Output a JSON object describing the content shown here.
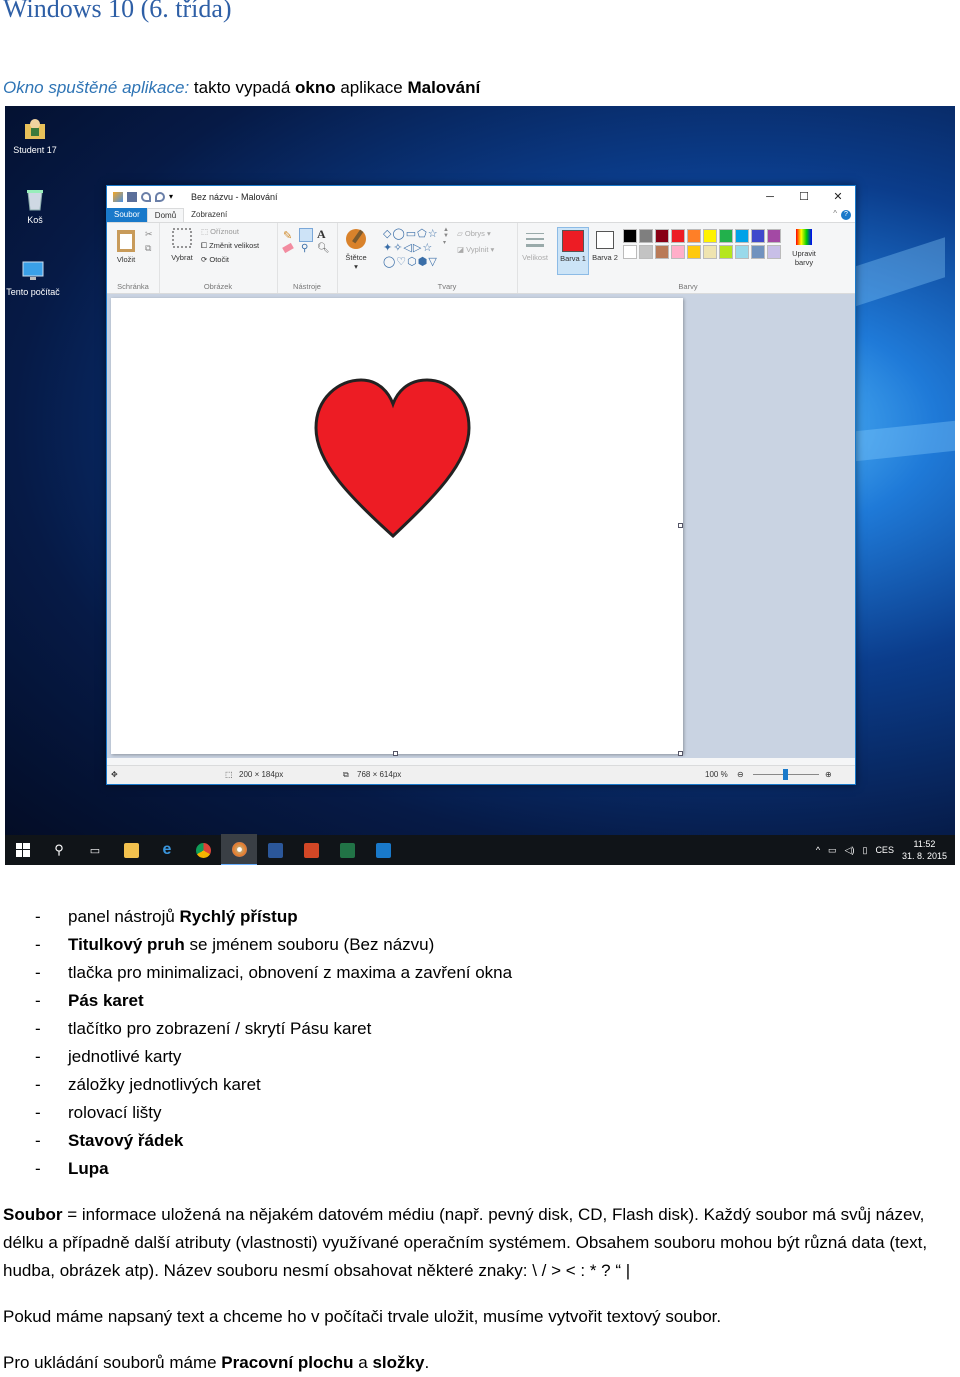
{
  "page": {
    "title": "Windows 10 (6. třída)",
    "intro": {
      "highlight": "Okno spuštěné aplikace:",
      "part1": " takto vypadá ",
      "bold1": "okno",
      "part2": " aplikace ",
      "bold2": "Malování"
    }
  },
  "screenshot": {
    "desktop_icons": [
      {
        "label": "Student 17",
        "icon": "user-folder-icon"
      },
      {
        "label": "Koš",
        "icon": "recycle-bin-icon"
      },
      {
        "label": "Tento počítač",
        "icon": "computer-icon"
      }
    ],
    "window": {
      "title": "Bez názvu - Malování",
      "controls": {
        "minimize": "─",
        "maximize": "☐",
        "close": "✕"
      },
      "tabs": [
        "Soubor",
        "Domů",
        "Zobrazení"
      ],
      "help": "?",
      "ribbon": {
        "groups": [
          "Schránka",
          "Obrázek",
          "Nástroje",
          "Tvary",
          "Barvy"
        ],
        "buttons": {
          "paste": "Vložit",
          "select": "Vybrat",
          "crop": "Oříznout",
          "resize": "Změnit velikost",
          "rotate": "Otočit",
          "brushes": "Štětce",
          "outline": "Obrys",
          "fill": "Vyplnit",
          "size": "Velikost",
          "color1": "Barva 1",
          "color2": "Barva 2",
          "edit_colors": "Upravit barvy"
        },
        "palette_row1": [
          "#000000",
          "#7f7f7f",
          "#880015",
          "#ed1c24",
          "#ff7f27",
          "#fff200",
          "#22b14c",
          "#00a2e8",
          "#3f48cc",
          "#a349a4"
        ],
        "palette_row2": [
          "#ffffff",
          "#c3c3c3",
          "#b97a57",
          "#ffaec9",
          "#ffc90e",
          "#efe4b0",
          "#b5e61d",
          "#99d9ea",
          "#7092be",
          "#c8bfe7"
        ],
        "color1_value": "#ed1c24"
      },
      "canvas": {
        "shape": "heart",
        "fill": "#ed1c24"
      },
      "statusbar": {
        "selection_size": "200 × 184px",
        "image_size": "768 × 614px",
        "zoom": "100 %",
        "zoom_out": "⊖",
        "zoom_in": "⊕"
      }
    },
    "taskbar": {
      "icons": [
        "start-icon",
        "search-icon",
        "task-view-icon",
        "file-explorer-icon",
        "edge-icon",
        "chrome-icon",
        "paint-icon",
        "word-icon",
        "powerpoint-icon",
        "excel-icon",
        "settings-icon"
      ],
      "lang": "CES",
      "time": "11:52",
      "date": "31. 8. 2015"
    }
  },
  "bullets": [
    {
      "pre": "panel nástrojů ",
      "bold": "Rychlý přístup",
      "post": ""
    },
    {
      "pre": "",
      "bold": "Titulkový pruh",
      "post": " se jménem souboru (Bez názvu)"
    },
    {
      "pre": "tlačka pro minimalizaci, obnovení z maxima a zavření okna",
      "bold": "",
      "post": ""
    },
    {
      "pre": "",
      "bold": "Pás karet",
      "post": ""
    },
    {
      "pre": "tlačítko pro zobrazení / skrytí Pásu karet",
      "bold": "",
      "post": ""
    },
    {
      "pre": "jednotlivé karty",
      "bold": "",
      "post": ""
    },
    {
      "pre": "záložky jednotlivých karet",
      "bold": "",
      "post": ""
    },
    {
      "pre": "rolovací lišty",
      "bold": "",
      "post": ""
    },
    {
      "pre": "",
      "bold": "Stavový řádek",
      "post": ""
    },
    {
      "pre": "",
      "bold": "Lupa",
      "post": ""
    }
  ],
  "paragraphs": {
    "file": {
      "bold": "Soubor",
      "text": " = informace uložená na nějakém datovém médiu (např. pevný disk, CD, Flash disk). Každý soubor má svůj název, délku a případně další atributy (vlastnosti) využívané operačním systémem. Obsahem souboru mohou být různá data (text, hudba, obrázek atp). Název souboru nesmí obsahovat některé znaky: \\ / > < : * ? “ |"
    },
    "save": "Pokud máme napsaný text a chceme ho v počítači trvale uložit, musíme vytvořit textový soubor.",
    "storage": {
      "text1": "Pro ukládání souborů máme ",
      "bold1": "Pracovní plochu",
      "text2": " a ",
      "bold2": "složky",
      "text3": "."
    }
  }
}
